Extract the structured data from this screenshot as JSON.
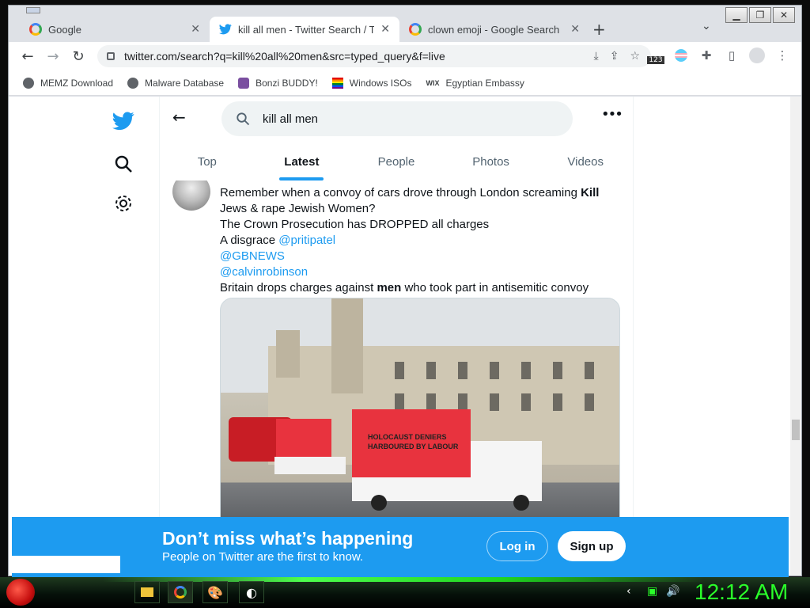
{
  "browser": {
    "tabs": [
      {
        "title": "Google",
        "icon": "google-icon"
      },
      {
        "title": "kill all men - Twitter Search / Twitt",
        "icon": "twitter-icon"
      },
      {
        "title": "clown emoji - Google Search",
        "icon": "google-icon"
      }
    ],
    "active_tab": 1,
    "url": "twitter.com/search?q=kill%20all%20men&src=typed_query&f=live",
    "bookmarks": [
      {
        "label": "MEMZ Download",
        "icon": "globe-icon"
      },
      {
        "label": "Malware Database",
        "icon": "globe-icon"
      },
      {
        "label": "Bonzi BUDDY!",
        "icon": "bonzi-icon"
      },
      {
        "label": "Windows ISOs",
        "icon": "windows-icon"
      },
      {
        "label": "Egyptian Embassy",
        "icon": "wix-icon"
      }
    ],
    "extension_badge": "123"
  },
  "twitter": {
    "search_query": "kill all men",
    "tabs": [
      "Top",
      "Latest",
      "People",
      "Photos",
      "Videos"
    ],
    "active_tab": "Latest",
    "tweet": {
      "line1": "Remember when a convoy of cars drove through London screaming ",
      "line1_bold": "Kill",
      "line2": "Jews & rape Jewish Women?",
      "line3": "The Crown Prosecution has DROPPED all charges",
      "line4": "A disgrace ",
      "mention1": "@pritipatel",
      "mention2": "@GBNEWS",
      "mention3": "@calvinrobinson",
      "line8a": "Britain drops charges against ",
      "line8_bold": "men",
      "line8b": " who took part in antisemitic convoy",
      "media": {
        "van_text_line1": "HOLOCAUST DENIERS",
        "van_text_line2": "HARBOURED BY LABOUR"
      }
    },
    "banner": {
      "title": "Don’t miss what’s happening",
      "subtitle": "People on Twitter are the first to know.",
      "login_label": "Log in",
      "signup_label": "Sign up"
    },
    "accent": "#1d9bf0"
  },
  "taskbar": {
    "clock": "12:12 AM",
    "clock_color": "#2aff2a"
  }
}
